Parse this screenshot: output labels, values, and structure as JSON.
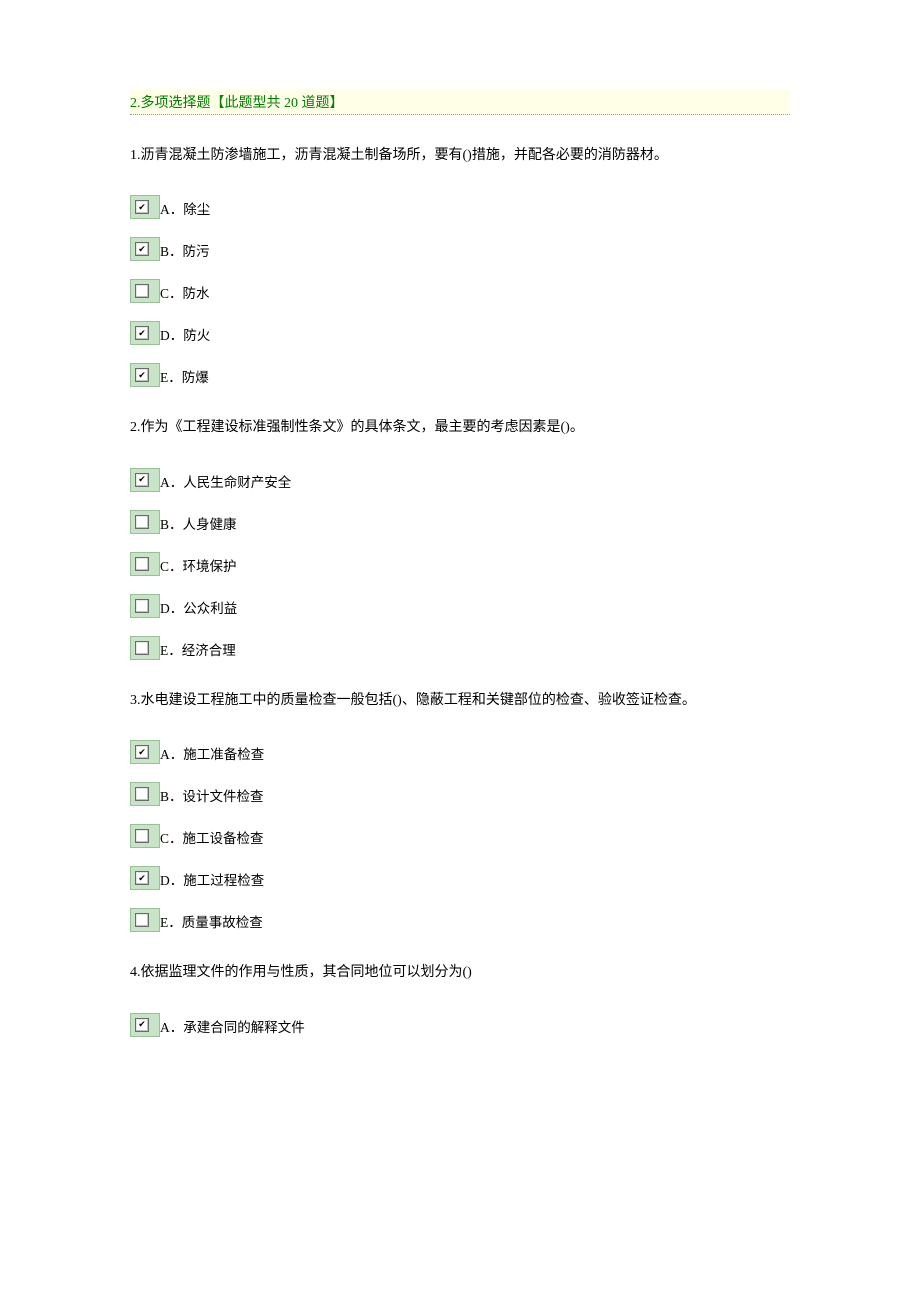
{
  "section_header": "2.多项选择题【此题型共 20 道题】",
  "questions": [
    {
      "text": "1.沥青混凝土防渗墙施工，沥青混凝土制备场所，要有()措施，并配各必要的消防器材。",
      "options": [
        {
          "letter": "A",
          "label": "除尘",
          "checked": true
        },
        {
          "letter": "B",
          "label": "防污",
          "checked": true
        },
        {
          "letter": "C",
          "label": "防水",
          "checked": false
        },
        {
          "letter": "D",
          "label": "防火",
          "checked": true
        },
        {
          "letter": "E",
          "label": "防爆",
          "checked": true
        }
      ]
    },
    {
      "text": "2.作为《工程建设标准强制性条文》的具体条文，最主要的考虑因素是()。",
      "options": [
        {
          "letter": "A",
          "label": "人民生命财产安全",
          "checked": true
        },
        {
          "letter": "B",
          "label": "人身健康",
          "checked": false
        },
        {
          "letter": "C",
          "label": "环境保护",
          "checked": false
        },
        {
          "letter": "D",
          "label": "公众利益",
          "checked": false
        },
        {
          "letter": "E",
          "label": "经济合理",
          "checked": false
        }
      ]
    },
    {
      "text": "3.水电建设工程施工中的质量检查一般包括()、隐蔽工程和关键部位的检查、验收签证检查。",
      "options": [
        {
          "letter": "A",
          "label": "施工准备检查",
          "checked": true
        },
        {
          "letter": "B",
          "label": "设计文件检查",
          "checked": false
        },
        {
          "letter": "C",
          "label": "施工设备检查",
          "checked": false
        },
        {
          "letter": "D",
          "label": "施工过程检查",
          "checked": true
        },
        {
          "letter": "E",
          "label": "质量事故检查",
          "checked": false
        }
      ]
    },
    {
      "text": "4.依据监理文件的作用与性质，其合同地位可以划分为()",
      "options": [
        {
          "letter": "A",
          "label": "承建合同的解释文件",
          "checked": true
        }
      ]
    }
  ],
  "checkmark": "✔"
}
